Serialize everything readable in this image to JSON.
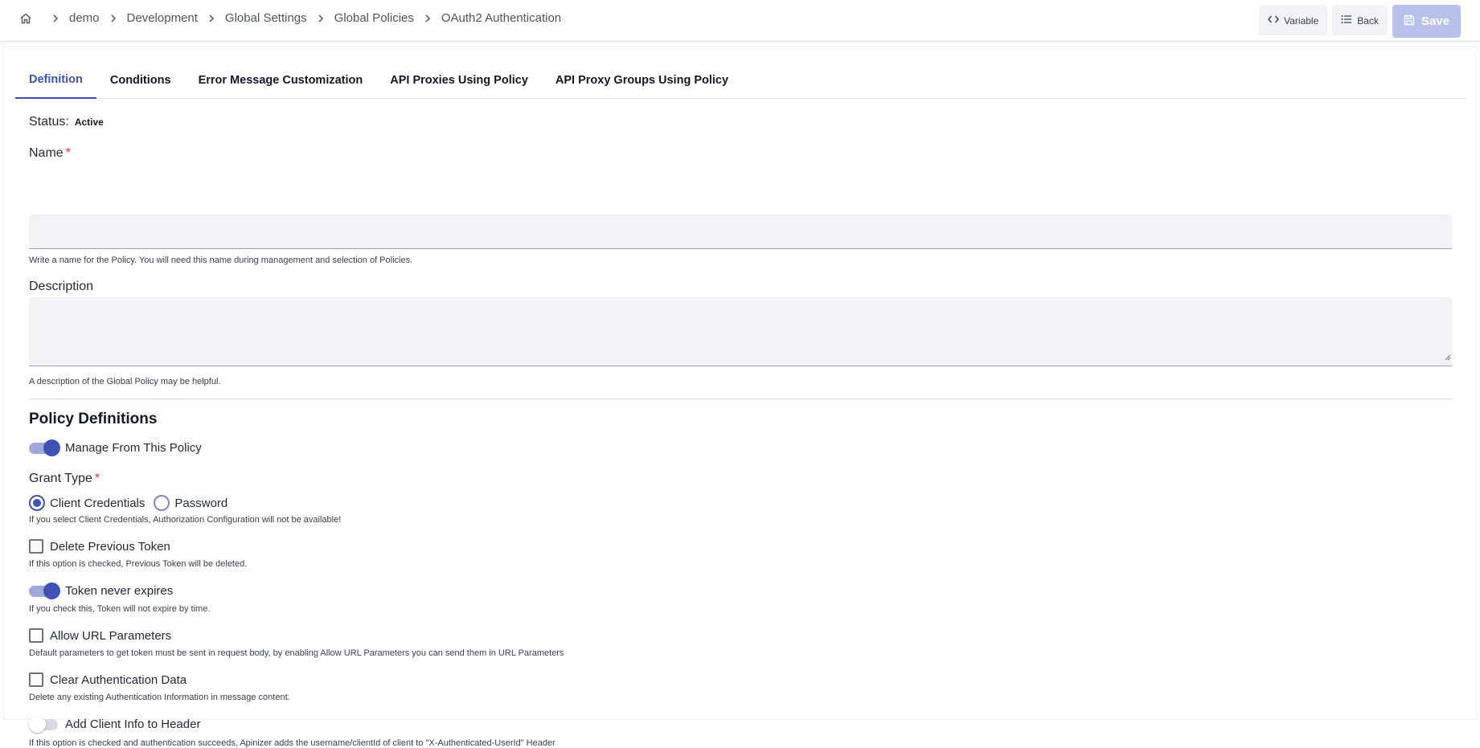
{
  "breadcrumb": {
    "home_icon": "home-icon",
    "items": [
      "demo",
      "Development",
      "Global Settings",
      "Global Policies",
      "OAuth2 Authentication"
    ]
  },
  "actions": {
    "variable_label": "Variable",
    "back_label": "Back",
    "save_label": "Save"
  },
  "tabs": [
    {
      "label": "Definition",
      "active": true
    },
    {
      "label": "Conditions",
      "active": false
    },
    {
      "label": "Error Message Customization",
      "active": false
    },
    {
      "label": "API Proxies Using Policy",
      "active": false
    },
    {
      "label": "API Proxy Groups Using Policy",
      "active": false
    }
  ],
  "status": {
    "label": "Status:",
    "value": "Active"
  },
  "name_field": {
    "label": "Name",
    "required_mark": "*",
    "value": "",
    "help": "Write a name for the Policy. You will need this name during management and selection of Policies."
  },
  "description_field": {
    "label": "Description",
    "value": "",
    "help": "A description of the Global Policy may be helpful."
  },
  "policy_definitions": {
    "title": "Policy Definitions",
    "manage_toggle": {
      "label": "Manage From This Policy",
      "on": true
    },
    "grant_type": {
      "label": "Grant Type",
      "required_mark": "*",
      "options": [
        "Client Credentials",
        "Password"
      ],
      "selected": "Client Credentials",
      "help": "If you select Client Credentials, Authorization Configuration will not be available!"
    },
    "delete_previous_token": {
      "label": "Delete Previous Token",
      "checked": false,
      "help": "If this option is checked, Previous Token will be deleted."
    },
    "token_never_expires": {
      "label": "Token never expires",
      "on": true,
      "help": "If you check this, Token will not expire by time."
    },
    "allow_url_parameters": {
      "label": "Allow URL Parameters",
      "checked": false,
      "help": "Default parameters to get token must be sent in request body, by enabling Allow URL Parameters you can send them in URL Parameters"
    },
    "clear_auth_data": {
      "label": "Clear Authentication Data",
      "checked": false,
      "help": "Delete any existing Authentication Information in message content."
    },
    "add_client_info": {
      "label": "Add Client Info to Header",
      "on": false,
      "help": "If this option is checked and authentication succeeds, Apinizer adds the username/clientId of client to \"X-Authenticated-UserId\" Header"
    }
  },
  "colors": {
    "accent": "#3f51b5",
    "save_disabled": "#b9c0ea",
    "required": "#e53935"
  }
}
